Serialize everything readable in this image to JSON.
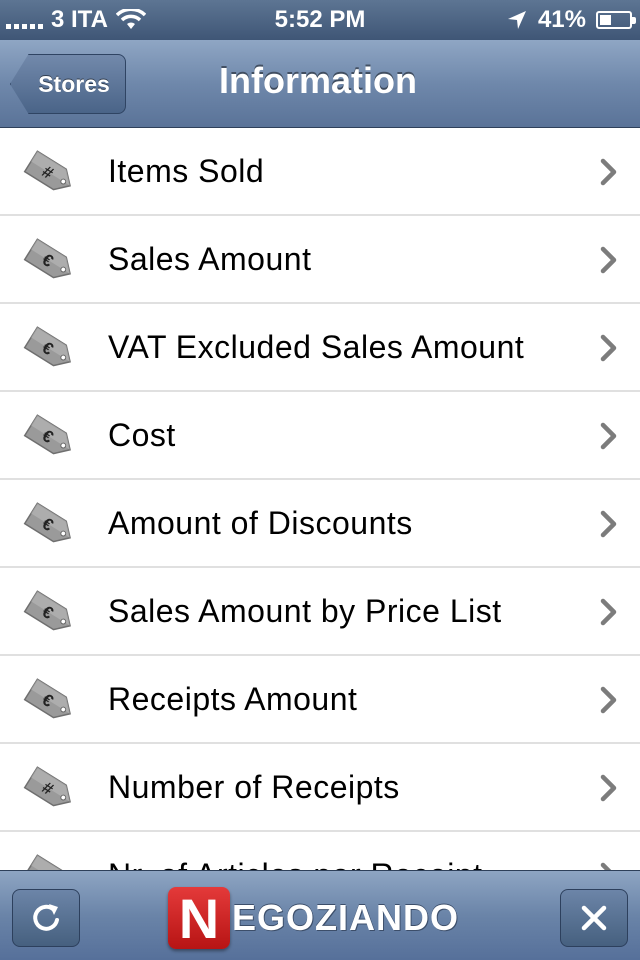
{
  "status_bar": {
    "carrier": "3 ITA",
    "time": "5:52 PM",
    "battery": "41%",
    "battery_level": 0.41
  },
  "nav": {
    "back_label": "Stores",
    "title": "Information"
  },
  "list": {
    "items": [
      {
        "label": "Items Sold",
        "icon": "tag-hash-icon"
      },
      {
        "label": "Sales Amount",
        "icon": "tag-euro-icon"
      },
      {
        "label": "VAT Excluded Sales Amount",
        "icon": "tag-euro-icon"
      },
      {
        "label": "Cost",
        "icon": "tag-euro-icon"
      },
      {
        "label": "Amount of Discounts",
        "icon": "tag-euro-icon"
      },
      {
        "label": "Sales Amount by Price List",
        "icon": "tag-euro-icon"
      },
      {
        "label": "Receipts Amount",
        "icon": "tag-euro-icon"
      },
      {
        "label": "Number of Receipts",
        "icon": "tag-hash-icon"
      },
      {
        "label": "Nr. of Articles per Receipt",
        "icon": "tag-hash-icon"
      }
    ]
  },
  "toolbar": {
    "logo_letter": "N",
    "logo_text": "EGOZIANDO"
  }
}
